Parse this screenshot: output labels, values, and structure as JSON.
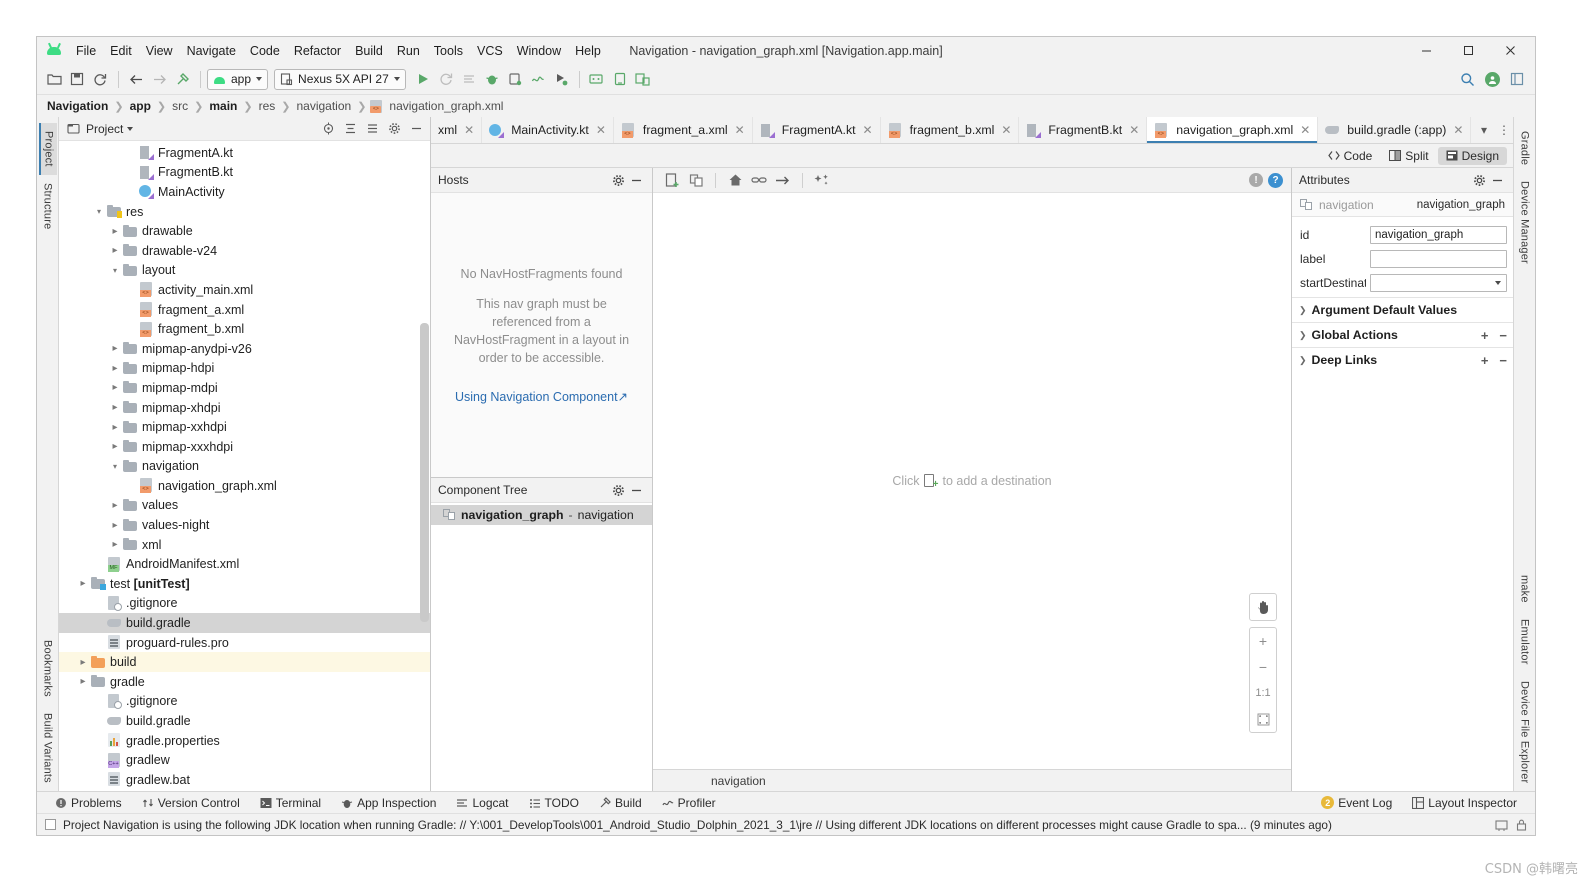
{
  "window": {
    "title": "Navigation - navigation_graph.xml [Navigation.app.main]",
    "minimize": "─",
    "maximize": "☐",
    "close": "✕"
  },
  "menu": {
    "items": [
      {
        "label": "File"
      },
      {
        "label": "Edit"
      },
      {
        "label": "View"
      },
      {
        "label": "Navigate"
      },
      {
        "label": "Code"
      },
      {
        "label": "Refactor"
      },
      {
        "label": "Build"
      },
      {
        "label": "Run"
      },
      {
        "label": "Tools"
      },
      {
        "label": "VCS"
      },
      {
        "label": "Window"
      },
      {
        "label": "Help"
      }
    ]
  },
  "toolbar": {
    "module_selector": "app",
    "device_selector": "Nexus 5X API 27",
    "icons": [
      "open-folder-icon",
      "save-icon",
      "sync-icon",
      "back-icon",
      "forward-icon",
      "build-hammer-icon",
      "run-icon",
      "apply-changes-icon",
      "apply-code-changes-icon",
      "debug-icon",
      "attach-debugger-icon",
      "profiler-icon",
      "run-with-coverage-icon",
      "sdk-manager-icon",
      "avd-manager-icon",
      "device-manager-icon"
    ],
    "search_icon": "search-icon",
    "account_icon": "account-icon",
    "layout_icon": "layout-icon"
  },
  "breadcrumb": {
    "items": [
      {
        "label": "Navigation",
        "bold": true
      },
      {
        "label": "app",
        "bold": true
      },
      {
        "label": "src",
        "bold": false
      },
      {
        "label": "main",
        "bold": true
      },
      {
        "label": "res",
        "bold": false
      },
      {
        "label": "navigation",
        "bold": false
      },
      {
        "label": "navigation_graph.xml",
        "bold": false,
        "icon": "xml-file-icon"
      }
    ]
  },
  "left_rail": {
    "items": [
      "Project",
      "Structure"
    ],
    "bottom_items": [
      "Bookmarks",
      "Build Variants"
    ]
  },
  "right_rail": {
    "items": [
      "Gradle",
      "Device Manager"
    ],
    "bottom_items": [
      "make",
      "Emulator",
      "Device File Explorer"
    ]
  },
  "project_panel": {
    "title": "Project",
    "header_icons": [
      "locate-icon",
      "collapse-all-icon",
      "expand-icon",
      "settings-icon",
      "hide-icon"
    ],
    "tree": [
      {
        "indent": 4,
        "twist": "",
        "icon": "kt",
        "label": "FragmentA.kt"
      },
      {
        "indent": 4,
        "twist": "",
        "icon": "kt",
        "label": "FragmentB.kt"
      },
      {
        "indent": 4,
        "twist": "",
        "icon": "cls",
        "label": "MainActivity"
      },
      {
        "indent": 2,
        "twist": "v",
        "icon": "folder-res",
        "label": "res"
      },
      {
        "indent": 3,
        "twist": ">",
        "icon": "folder",
        "label": "drawable"
      },
      {
        "indent": 3,
        "twist": ">",
        "icon": "folder",
        "label": "drawable-v24"
      },
      {
        "indent": 3,
        "twist": "v",
        "icon": "folder",
        "label": "layout"
      },
      {
        "indent": 4,
        "twist": "",
        "icon": "xml",
        "label": "activity_main.xml"
      },
      {
        "indent": 4,
        "twist": "",
        "icon": "xml",
        "label": "fragment_a.xml"
      },
      {
        "indent": 4,
        "twist": "",
        "icon": "xml",
        "label": "fragment_b.xml"
      },
      {
        "indent": 3,
        "twist": ">",
        "icon": "folder",
        "label": "mipmap-anydpi-v26"
      },
      {
        "indent": 3,
        "twist": ">",
        "icon": "folder",
        "label": "mipmap-hdpi"
      },
      {
        "indent": 3,
        "twist": ">",
        "icon": "folder",
        "label": "mipmap-mdpi"
      },
      {
        "indent": 3,
        "twist": ">",
        "icon": "folder",
        "label": "mipmap-xhdpi"
      },
      {
        "indent": 3,
        "twist": ">",
        "icon": "folder",
        "label": "mipmap-xxhdpi"
      },
      {
        "indent": 3,
        "twist": ">",
        "icon": "folder",
        "label": "mipmap-xxxhdpi"
      },
      {
        "indent": 3,
        "twist": "v",
        "icon": "folder",
        "label": "navigation"
      },
      {
        "indent": 4,
        "twist": "",
        "icon": "xml",
        "label": "navigation_graph.xml"
      },
      {
        "indent": 3,
        "twist": ">",
        "icon": "folder",
        "label": "values"
      },
      {
        "indent": 3,
        "twist": ">",
        "icon": "folder",
        "label": "values-night"
      },
      {
        "indent": 3,
        "twist": ">",
        "icon": "folder",
        "label": "xml"
      },
      {
        "indent": 2,
        "twist": "",
        "icon": "xml-green",
        "label": "AndroidManifest.xml"
      },
      {
        "indent": 1,
        "twist": ">",
        "icon": "folder-test",
        "label": "test [unitTest]",
        "bold_tail": true
      },
      {
        "indent": 2,
        "twist": "",
        "icon": "gitign",
        "label": ".gitignore"
      },
      {
        "indent": 2,
        "twist": "",
        "icon": "gradle",
        "label": "build.gradle",
        "state": "selected"
      },
      {
        "indent": 2,
        "twist": "",
        "icon": "pro",
        "label": "proguard-rules.pro"
      },
      {
        "indent": 1,
        "twist": ">",
        "icon": "folder-orange",
        "label": "build",
        "state": "highlight"
      },
      {
        "indent": 1,
        "twist": ">",
        "icon": "folder",
        "label": "gradle"
      },
      {
        "indent": 2,
        "twist": "",
        "icon": "gitign",
        "label": ".gitignore"
      },
      {
        "indent": 2,
        "twist": "",
        "icon": "gradle",
        "label": "build.gradle"
      },
      {
        "indent": 2,
        "twist": "",
        "icon": "props",
        "label": "gradle.properties"
      },
      {
        "indent": 2,
        "twist": "",
        "icon": "xml-purple",
        "label": "gradlew"
      },
      {
        "indent": 2,
        "twist": "",
        "icon": "pro",
        "label": "gradlew.bat"
      }
    ]
  },
  "editor_tabs": {
    "tabs": [
      {
        "label": "xml",
        "icon": "xml-file-icon",
        "active": false,
        "truncated": true
      },
      {
        "label": "MainActivity.kt",
        "icon": "kotlin-class-icon",
        "active": false
      },
      {
        "label": "fragment_a.xml",
        "icon": "xml-file-icon",
        "active": false
      },
      {
        "label": "FragmentA.kt",
        "icon": "kotlin-file-icon",
        "active": false
      },
      {
        "label": "fragment_b.xml",
        "icon": "xml-file-icon",
        "active": false
      },
      {
        "label": "FragmentB.kt",
        "icon": "kotlin-file-icon",
        "active": false
      },
      {
        "label": "navigation_graph.xml",
        "icon": "xml-file-icon",
        "active": true
      },
      {
        "label": "build.gradle (:app)",
        "icon": "gradle-file-icon",
        "active": false
      }
    ],
    "chevron": "▾",
    "more": "⋮"
  },
  "mode_bar": {
    "modes": [
      {
        "label": "Code",
        "icon": "code-icon",
        "active": false
      },
      {
        "label": "Split",
        "icon": "split-icon",
        "active": false
      },
      {
        "label": "Design",
        "icon": "design-icon",
        "active": true
      }
    ]
  },
  "hosts_panel": {
    "title": "Hosts",
    "settings_icon": "gear-icon",
    "hide_icon": "minimize-icon",
    "empty_title": "No NavHostFragments found",
    "empty_message": "This nav graph must be referenced from a NavHostFragment in a layout in order to be accessible.",
    "link_label": "Using Navigation Component",
    "link_arrow": "↗"
  },
  "component_tree": {
    "title": "Component Tree",
    "settings_icon": "gear-icon",
    "hide_icon": "minimize-icon",
    "rows": [
      {
        "name": "navigation_graph",
        "type": "navigation",
        "icon": "nav-graph-icon",
        "selected": true
      }
    ]
  },
  "canvas": {
    "toolbar_icons": [
      "new-destination-icon",
      "new-nested-graph-icon",
      "set-start-destination-icon",
      "add-action-icon",
      "auto-arrange-icon",
      "zoom-to-fit-icon"
    ],
    "warning_badge": "!",
    "help_badge": "?",
    "empty_prefix": "Click",
    "empty_suffix": "to add a destination",
    "empty_icon": "new-destination-icon",
    "zoom_controls": [
      {
        "name": "pan-tool",
        "glyph": "✋"
      },
      {
        "name": "zoom-in",
        "glyph": "+"
      },
      {
        "name": "zoom-out",
        "glyph": "−"
      },
      {
        "name": "zoom-actual",
        "glyph": "1:1"
      },
      {
        "name": "zoom-to-fit",
        "glyph": "⛶"
      }
    ],
    "footer_label": "navigation"
  },
  "attributes_panel": {
    "title": "Attributes",
    "settings_icon": "gear-icon",
    "hide_icon": "minimize-icon",
    "subject_type": "navigation",
    "subject_name": "navigation_graph",
    "fields": [
      {
        "label": "id",
        "value": "navigation_graph",
        "kind": "text"
      },
      {
        "label": "label",
        "value": "",
        "kind": "text"
      },
      {
        "label": "startDestinati...",
        "value": "",
        "kind": "dropdown"
      }
    ],
    "sections": [
      {
        "label": "Argument Default Values",
        "has_add": false,
        "has_remove": false
      },
      {
        "label": "Global Actions",
        "has_add": true,
        "has_remove": true
      },
      {
        "label": "Deep Links",
        "has_add": true,
        "has_remove": true
      }
    ]
  },
  "tool_window_bar": {
    "items": [
      {
        "label": "Problems",
        "icon": "problems-icon"
      },
      {
        "label": "Version Control",
        "icon": "vcs-icon"
      },
      {
        "label": "Terminal",
        "icon": "terminal-icon"
      },
      {
        "label": "App Inspection",
        "icon": "inspection-icon"
      },
      {
        "label": "Logcat",
        "icon": "logcat-icon"
      },
      {
        "label": "TODO",
        "icon": "todo-icon"
      },
      {
        "label": "Build",
        "icon": "build-icon"
      },
      {
        "label": "Profiler",
        "icon": "profiler-icon"
      }
    ],
    "right_items": [
      {
        "label": "Event Log",
        "icon": "event-log-icon",
        "badge": "2"
      },
      {
        "label": "Layout Inspector",
        "icon": "layout-inspector-icon"
      }
    ]
  },
  "status_bar": {
    "message": "Project Navigation is using the following JDK location when running Gradle: // Y:\\001_DevelopTools\\001_Android_Studio_Dolphin_2021_3_1\\jre // Using different JDK locations on different processes might cause Gradle to spa... (9 minutes ago)",
    "right_icons": [
      "memory-icon",
      "lock-icon",
      "notification-icon"
    ]
  },
  "watermark": "CSDN @韩曙亮"
}
